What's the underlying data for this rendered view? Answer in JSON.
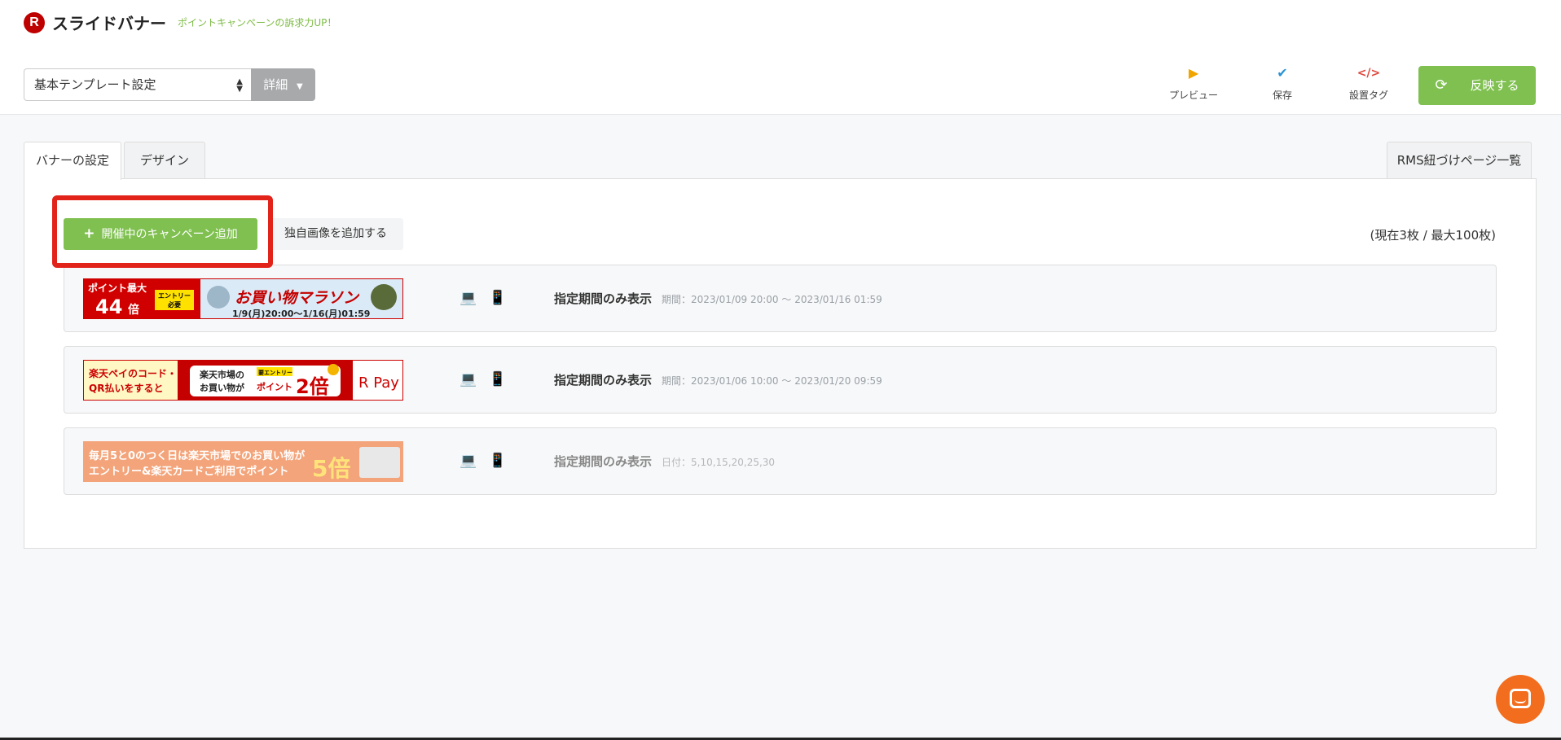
{
  "header": {
    "logo_letter": "R",
    "title": "スライドバナー",
    "subtitle": "ポイントキャンペーンの訴求力UP！",
    "template_select": "基本テンプレート設定",
    "detail_label": "詳細",
    "tools": [
      {
        "label": "プレビュー",
        "icon": "play-icon"
      },
      {
        "label": "保存",
        "icon": "check-icon"
      },
      {
        "label": "設置タグ",
        "icon": "code-icon"
      }
    ],
    "reflect_label": "反映する"
  },
  "tabs": [
    {
      "label": "バナーの設定",
      "active": true
    },
    {
      "label": "デザイン",
      "active": false
    }
  ],
  "rms_label": "RMS紐づけページ一覧",
  "actions": {
    "add_campaign": "開催中のキャンペーン追加",
    "add_own_image": "独自画像を追加する",
    "count": "(現在3枚 / 最大100枚)"
  },
  "banners": [
    {
      "texts": [
        "ポイント最大",
        "44",
        "倍",
        "エントリー",
        "必要",
        "お買い物マラソン",
        "1/9(月)20:00〜1/16(月)01:59"
      ],
      "display": "指定期間のみ表示",
      "period": "期間：2023/01/09 20:00 〜 2023/01/16 01:59"
    },
    {
      "texts": [
        "楽天ペイのコード・",
        "QR払いをすると",
        "楽天市場の",
        "お買い物が",
        "要エントリー",
        "ポイント",
        "2倍",
        "R Pay"
      ],
      "display": "指定期間のみ表示",
      "period": "期間：2023/01/06 10:00 〜 2023/01/20 09:59"
    },
    {
      "texts": [
        "毎月5と0のつく日は楽天市場でのお買い物が",
        "エントリー&楽天カードご利用でポイント",
        "5倍"
      ],
      "display": "指定期間のみ表示",
      "period": "日付：5,10,15,20,25,30"
    }
  ],
  "colors": {
    "green": "#7fc050",
    "highlight_red": "#e2231a",
    "brand_red": "#bf0000",
    "device_blue": "#2a93d5",
    "chat_orange": "#f26d1d"
  }
}
